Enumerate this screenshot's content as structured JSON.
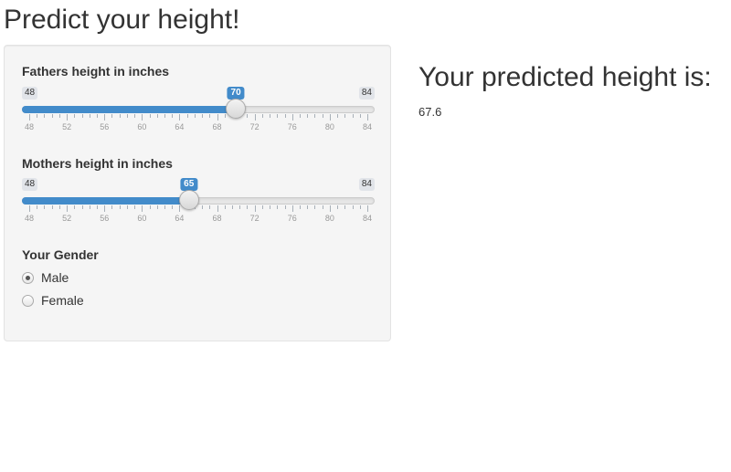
{
  "page": {
    "title": "Predict your height!"
  },
  "sidebar": {
    "father": {
      "label": "Fathers height in inches",
      "min": 48,
      "max": 84,
      "value": 70,
      "min_label": "48",
      "max_label": "84",
      "value_label": "70",
      "tick_labels": [
        "48",
        "52",
        "56",
        "60",
        "64",
        "68",
        "72",
        "76",
        "80",
        "84"
      ]
    },
    "mother": {
      "label": "Mothers height in inches",
      "min": 48,
      "max": 84,
      "value": 65,
      "min_label": "48",
      "max_label": "84",
      "value_label": "65",
      "tick_labels": [
        "48",
        "52",
        "56",
        "60",
        "64",
        "68",
        "72",
        "76",
        "80",
        "84"
      ]
    },
    "gender": {
      "label": "Your Gender",
      "options": [
        {
          "label": "Male",
          "checked": true
        },
        {
          "label": "Female",
          "checked": false
        }
      ]
    }
  },
  "main": {
    "heading": "Your predicted height is:",
    "value": "67.6"
  },
  "colors": {
    "accent": "#428bca",
    "panel_bg": "#f5f5f5"
  }
}
